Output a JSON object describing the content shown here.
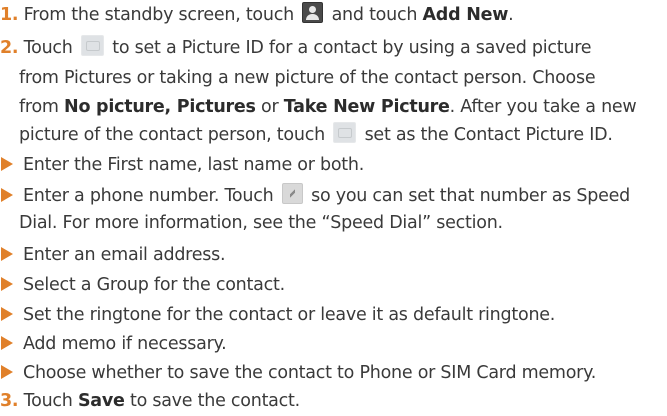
{
  "steps": [
    {
      "number": "1.",
      "pre": " From the standby screen, touch ",
      "mid": " and touch ",
      "bold": "Add New",
      "post": "."
    },
    {
      "number": "2.",
      "pre": " Touch ",
      "post": " to set a Picture ID for a contact by using a saved picture"
    }
  ],
  "step2_line2": "from Pictures or taking a new picture of the contact person. Choose",
  "step2_line3": {
    "pre": "from ",
    "bold1": "No picture, Pictures",
    "mid": " or ",
    "bold2": "Take New Picture",
    "post": ". After you take a new"
  },
  "step2_line4": {
    "pre": "picture of the contact person, touch ",
    "post": " set as the Contact Picture ID."
  },
  "bullets": {
    "b1": "Enter the First name, last name or both.",
    "b2_pre": "Enter a phone number. Touch ",
    "b2_post": " so you can set that number as Speed",
    "b2_line2": "Dial. For more information, see the “Speed Dial” section.",
    "b3": "Enter an email address.",
    "b4": "Select a Group for the contact.",
    "b5": "Set the ringtone for the contact or leave it as default ringtone.",
    "b6": "Add memo if necessary.",
    "b7": "Choose whether to save the contact to Phone or SIM Card memory."
  },
  "step3": {
    "number": "3.",
    "pre": " Touch ",
    "bold": "Save",
    "post": " to save the contact."
  },
  "icons": {
    "contacts": "contacts-icon",
    "picture": "picture-id-icon",
    "speed_dial": "speed-dial-icon"
  },
  "colors": {
    "accent": "#e0802a",
    "text": "#3a3a3a"
  }
}
